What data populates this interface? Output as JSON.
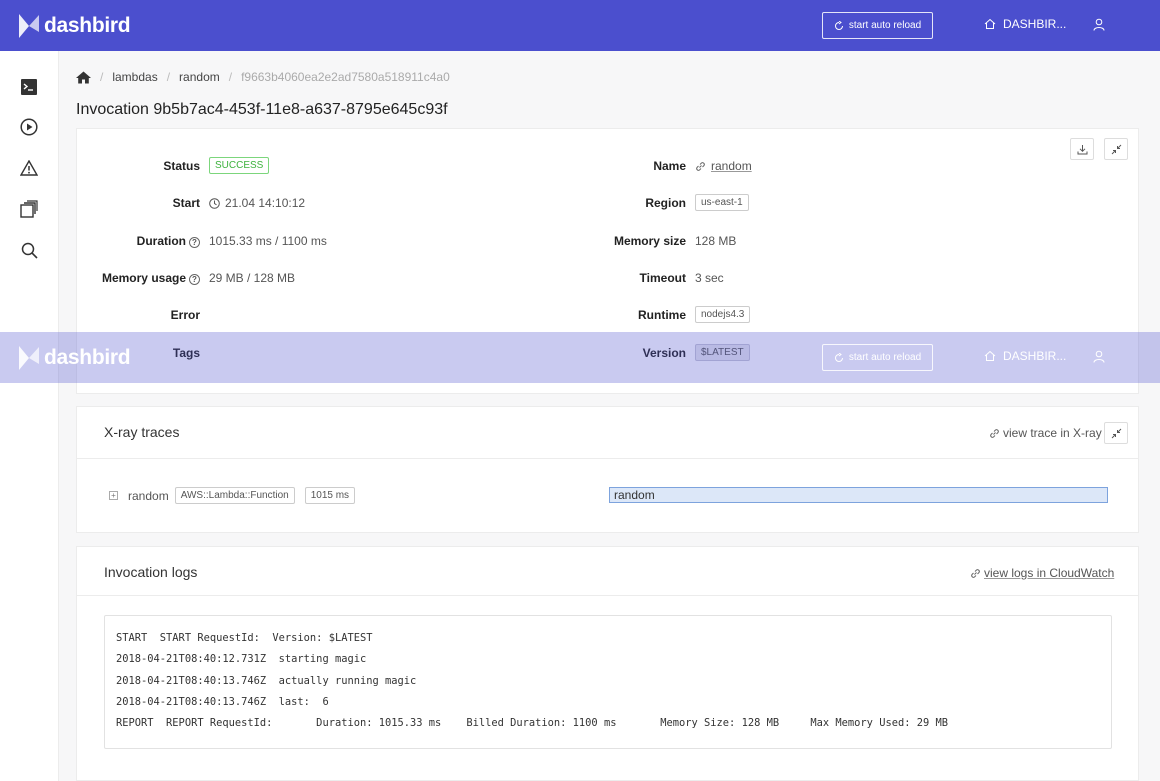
{
  "brand": {
    "name": "dashbird"
  },
  "topbar": {
    "reload_label": "start auto reload",
    "account_label": "DASHBIR..."
  },
  "colors": {
    "brand": "#4b4fce",
    "success": "#3eb23e",
    "trace_bar": "#dce7f8"
  },
  "breadcrumb": {
    "items": [
      "lambdas",
      "random"
    ],
    "current": "f9663b4060ea2e2ad7580a518911c4a0"
  },
  "page_title": "Invocation 9b5b7ac4-453f-11e8-a637-8795e645c93f",
  "details": {
    "left": {
      "status_label": "Status",
      "status_value": "SUCCESS",
      "start_label": "Start",
      "start_value": "21.04 14:10:12",
      "duration_label": "Duration",
      "duration_value": "1015.33 ms / 1100 ms",
      "memory_usage_label": "Memory usage",
      "memory_usage_value": "29 MB / 128 MB",
      "error_label": "Error",
      "tags_label": "Tags"
    },
    "right": {
      "name_label": "Name",
      "name_value": "random",
      "region_label": "Region",
      "region_value": "us-east-1",
      "memory_size_label": "Memory size",
      "memory_size_value": "128 MB",
      "timeout_label": "Timeout",
      "timeout_value": "3 sec",
      "runtime_label": "Runtime",
      "runtime_value": "nodejs4.3",
      "version_label": "Version",
      "version_value": "$LATEST"
    }
  },
  "xray": {
    "title": "X-ray traces",
    "link_label": "view trace in X-ray",
    "trace": {
      "name": "random",
      "type": "AWS::Lambda::Function",
      "duration": "1015 ms",
      "bar_label": "random"
    }
  },
  "logs": {
    "title": "Invocation logs",
    "link_label": "view logs in CloudWatch",
    "lines": [
      "START  START RequestId:  Version: $LATEST",
      "2018-04-21T08:40:12.731Z  starting magic",
      "2018-04-21T08:40:13.746Z  actually running magic",
      "2018-04-21T08:40:13.746Z  last:  6",
      "REPORT  REPORT RequestId:       Duration: 1015.33 ms    Billed Duration: 1100 ms       Memory Size: 128 MB     Max Memory Used: 29 MB"
    ]
  }
}
